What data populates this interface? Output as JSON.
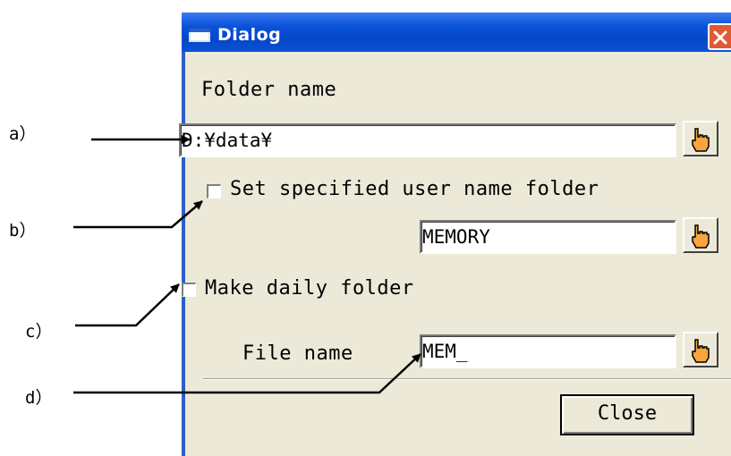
{
  "dialog": {
    "title": "Dialog",
    "folder_label": "Folder name",
    "folder_value": "D:¥data¥",
    "user_folder_label": "Set specified user name folder",
    "user_folder_checked": false,
    "user_folder_value": "MEMORY",
    "daily_folder_label": "Make daily folder",
    "daily_folder_checked": false,
    "file_name_label": "File name",
    "file_name_value": "MEM_",
    "close_label": "Close"
  },
  "annotations": {
    "a": "a）",
    "b": "b）",
    "c": "c）",
    "d": "d）"
  },
  "icons": {
    "browse": "pointing-hand-icon",
    "window": "window-icon",
    "close": "close-x-icon"
  },
  "colors": {
    "titlebar": "#0a52d8",
    "dialog_bg": "#ece9d8",
    "close_button": "#e05a38"
  }
}
